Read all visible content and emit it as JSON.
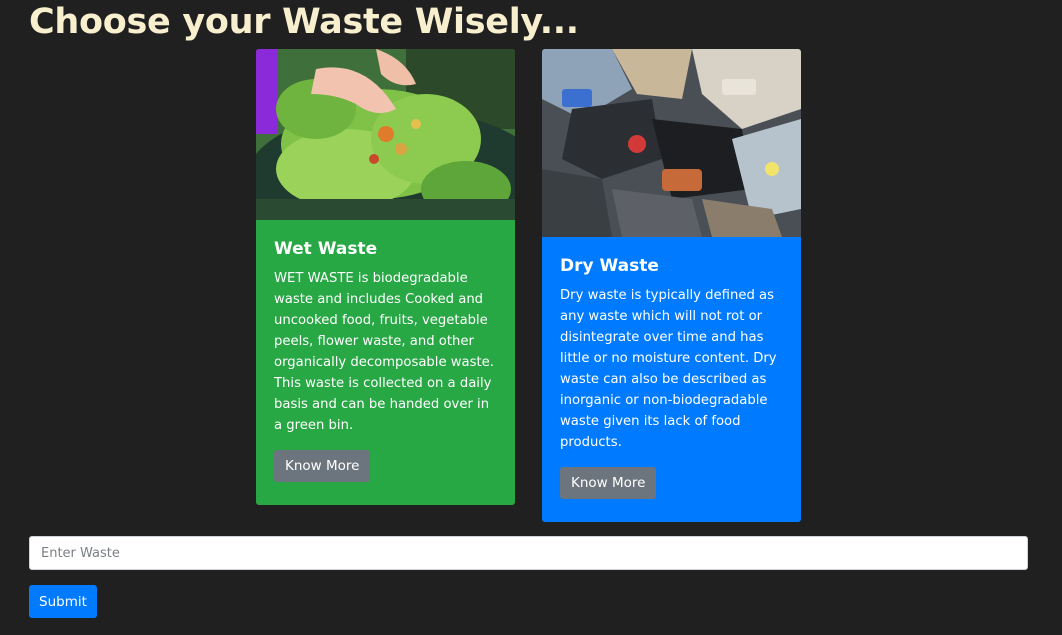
{
  "header": {
    "title": "Choose your Waste Wisely..."
  },
  "cards": [
    {
      "title": "Wet Waste",
      "text": "WET WASTE is biodegradable waste and includes Cooked and uncooked food, fruits, vegetable peels, flower waste, and other organically decomposable waste. This waste is collected on a daily basis and can be handed over in a green bin.",
      "button_label": "Know More",
      "image": "compost-vegetables-photo",
      "color": "#28a745"
    },
    {
      "title": "Dry Waste",
      "text": "Dry waste is typically defined as any waste which will not rot or disintegrate over time and has little or no moisture content. Dry waste can also be described as inorganic or non-biodegradable waste given its lack of food products.",
      "button_label": "Know More",
      "image": "plastic-trash-pile-photo",
      "color": "#007bff"
    }
  ],
  "form": {
    "input_placeholder": "Enter Waste",
    "input_value": "",
    "submit_label": "Submit"
  },
  "colors": {
    "background": "#202020",
    "title": "#f8efcf",
    "secondary_button": "#6c757d",
    "primary": "#007bff",
    "success": "#28a745"
  }
}
